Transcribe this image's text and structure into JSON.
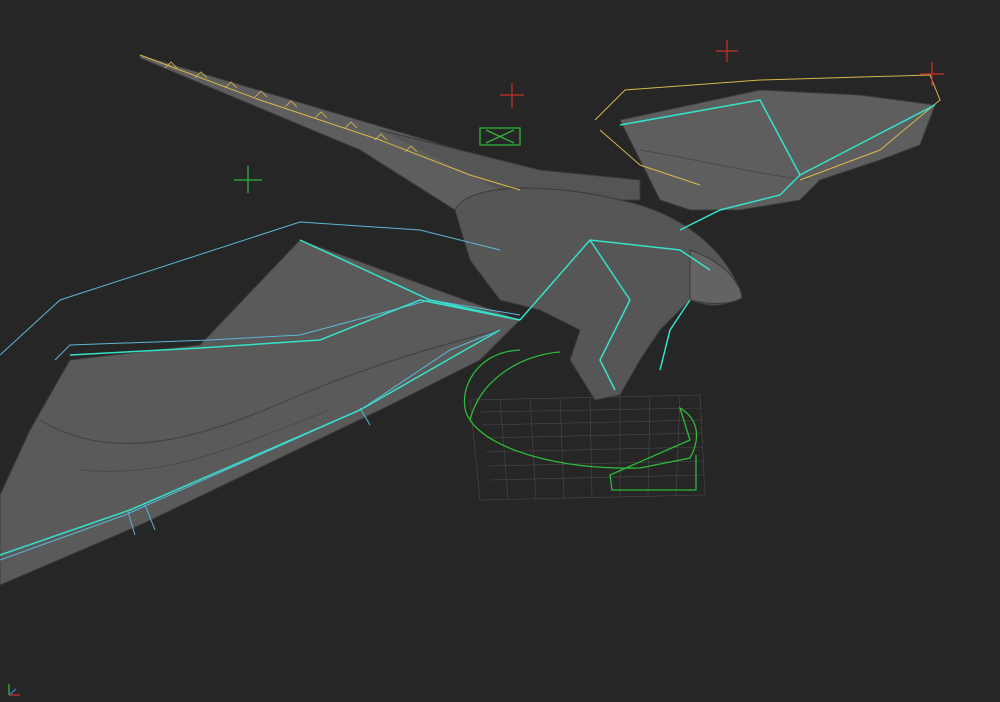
{
  "viewport": {
    "background": "#262626",
    "mesh_color": "#5a5a5a",
    "mesh_shadow": "#3c3c3c",
    "bone_color": "#35e2c9",
    "control_cyan": "#5fb6d8",
    "control_yellow": "#d8b84a",
    "control_green": "#2fb83a",
    "locator_red": "#c8322a",
    "grid_color": "#4a4a4a"
  },
  "icons": {
    "axis_gizmo": "axis-gizmo-icon",
    "root_control": "root-arrow-control-icon",
    "head_control": "x-shape-control-icon"
  }
}
